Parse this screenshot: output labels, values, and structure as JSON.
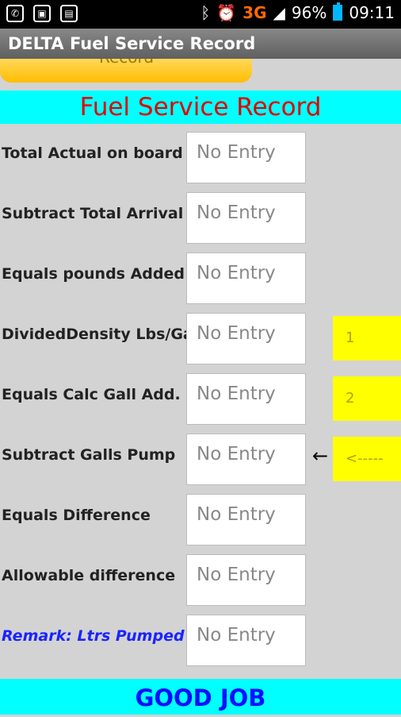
{
  "statusbar": {
    "network": "3G",
    "battery": "96%",
    "time": "09:11"
  },
  "app": {
    "title": "DELTA Fuel Service Record",
    "record_button": "Record"
  },
  "header": "Fuel Service Record",
  "rows": [
    {
      "label": "Total Actual on board",
      "value": "No Entry"
    },
    {
      "label": "Subtract Total Arrival",
      "value": "No Entry"
    },
    {
      "label": "Equals pounds Added",
      "value": "No Entry"
    },
    {
      "label": "DividedDensity Lbs/Gal",
      "value": "No Entry"
    },
    {
      "label": "Equals Calc Gall Add.",
      "value": "No Entry"
    },
    {
      "label": "Subtract Galls Pump",
      "value": "No Entry"
    },
    {
      "label": "Equals Difference",
      "value": "No Entry"
    },
    {
      "label": "Allowable difference",
      "value": "No Entry"
    },
    {
      "label": "Remark: Ltrs Pumped",
      "value": "No Entry"
    }
  ],
  "side_buttons": [
    "1",
    "2",
    "<-----"
  ],
  "arrow": "←",
  "footer": "GOOD JOB",
  "colors": {
    "header_band": "#00ffff",
    "header_text": "#e00000",
    "footer_text": "#0010ff",
    "side_buttons": "#ffff00",
    "remark_text": "#1a24ff"
  }
}
